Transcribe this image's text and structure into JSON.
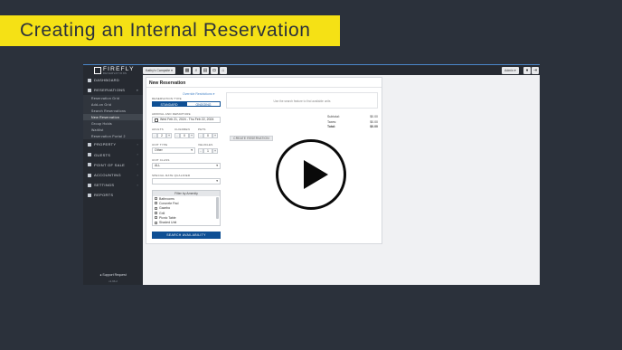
{
  "banner": {
    "title": "Creating an Internal Reservation"
  },
  "topbar": {
    "logo_text": "FIREFLY",
    "logo_sub": "RESERVATIONS",
    "property_select": "Kathy's Campsite ▾",
    "user_menu": "Admin ▾",
    "icons": [
      "grid-icon",
      "search-icon",
      "print-icon",
      "lock-icon",
      "home-icon",
      "bell-icon",
      "logout-icon"
    ]
  },
  "sidebar": {
    "items": [
      {
        "label": "DASHBOARD",
        "icon": "dashboard-icon"
      },
      {
        "label": "RESERVATIONS",
        "icon": "calendar-icon",
        "chevron": "▾"
      },
      {
        "label": "PROPERTY",
        "icon": "building-icon",
        "chevron": "›"
      },
      {
        "label": "GUESTS",
        "icon": "users-icon",
        "chevron": "›"
      },
      {
        "label": "POINT OF SALE",
        "icon": "cart-icon",
        "chevron": "›"
      },
      {
        "label": "ACCOUNTING",
        "icon": "ledger-icon",
        "chevron": "›"
      },
      {
        "label": "SETTINGS",
        "icon": "gear-icon",
        "chevron": "›"
      },
      {
        "label": "REPORTS",
        "icon": "chart-icon"
      }
    ],
    "sub_items": [
      "Reservation Grid",
      "Add-on Grid",
      "Search Reservations",
      "New Reservation",
      "Group Holds",
      "Waitlist",
      "Reservation Portal 2"
    ],
    "active_sub": "New Reservation",
    "support": "Support Request",
    "version": "v1.96.2"
  },
  "form": {
    "title": "New Reservation",
    "override_link": "Override Restrictions ▾",
    "reservation_type_label": "RESERVATION TYPE",
    "type_standard": "STANDARD",
    "type_ongoing": "ONGOING",
    "arrival_label": "ARRIVAL AND DEPARTURE",
    "dates": "Wed Feb 21, 2024 - Thu Feb 22, 2024",
    "adults_label": "ADULTS",
    "children_label": "CHILDREN",
    "pets_label": "PETS",
    "adults": "2",
    "children": "0",
    "pets": "0",
    "unit_type_label": "UNIT TYPE",
    "vehicles_label": "VEHICLES",
    "unit_type": "Other",
    "vehicles": "1",
    "unit_class_label": "UNIT CLASS",
    "unit_class": "ALL",
    "special_rate_label": "SPECIAL RATE QUALIFIER",
    "special_rate": "",
    "amenity_header": "Filter by Amenity",
    "amenities": [
      "Bathrooms",
      "Concrete Pad",
      "Gazebo",
      "Grill",
      "Picnic Table",
      "Shaded Unit"
    ],
    "search_button": "SEARCH AVAILABILITY"
  },
  "results": {
    "hint": "Use the search feature to find available units",
    "subtotal_label": "Subtotal:",
    "subtotal": "$0.00",
    "taxes_label": "Taxes:",
    "taxes": "$0.00",
    "total_label": "Total:",
    "total": "$0.00",
    "create_button": "CREATE RESERVATION"
  }
}
